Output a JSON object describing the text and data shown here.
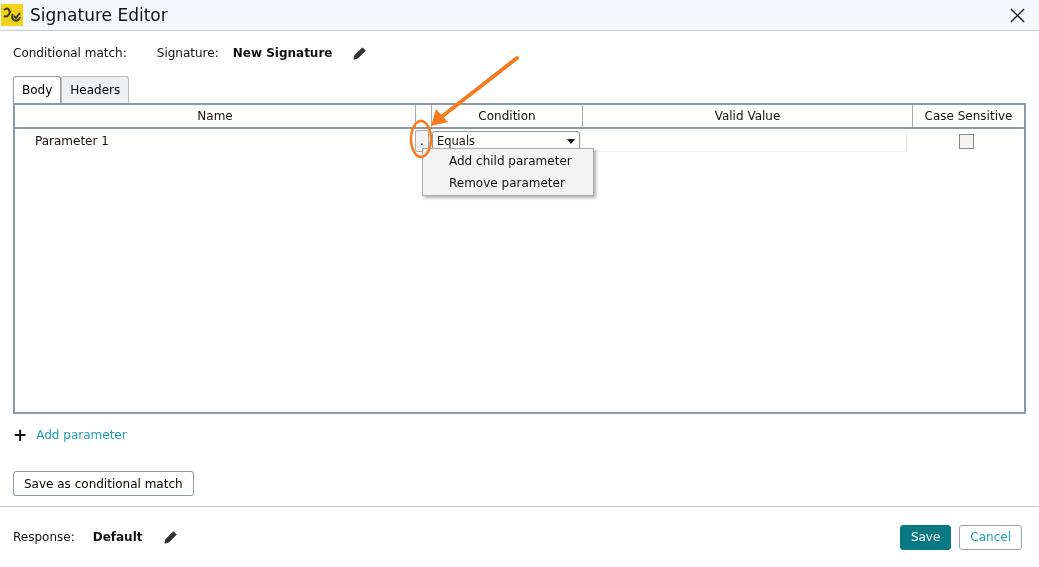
{
  "window": {
    "title": "Signature Editor"
  },
  "header": {
    "label": "Conditional match:",
    "signature_label": "Signature:",
    "signature_name": "New Signature"
  },
  "tabs": [
    {
      "label": "Body",
      "selected": true
    },
    {
      "label": "Headers",
      "selected": false
    }
  ],
  "table": {
    "columns": [
      "Name",
      "Condition",
      "Valid Value",
      "Case Sensitive"
    ],
    "rows": [
      {
        "name": "Parameter 1",
        "more_button": ".",
        "condition": "Equals",
        "case_sensitive": false
      }
    ]
  },
  "context_menu": [
    "Add child parameter",
    "Remove parameter"
  ],
  "add_parameter": {
    "icon": "+",
    "label": "Add parameter"
  },
  "save_conditional_button": "Save as conditional match",
  "footer": {
    "response_label": "Response:",
    "response_value": "Default",
    "buttons": [
      {
        "label": "Save",
        "kind": "primary"
      },
      {
        "label": "Cancel",
        "kind": "secondary"
      }
    ]
  }
}
